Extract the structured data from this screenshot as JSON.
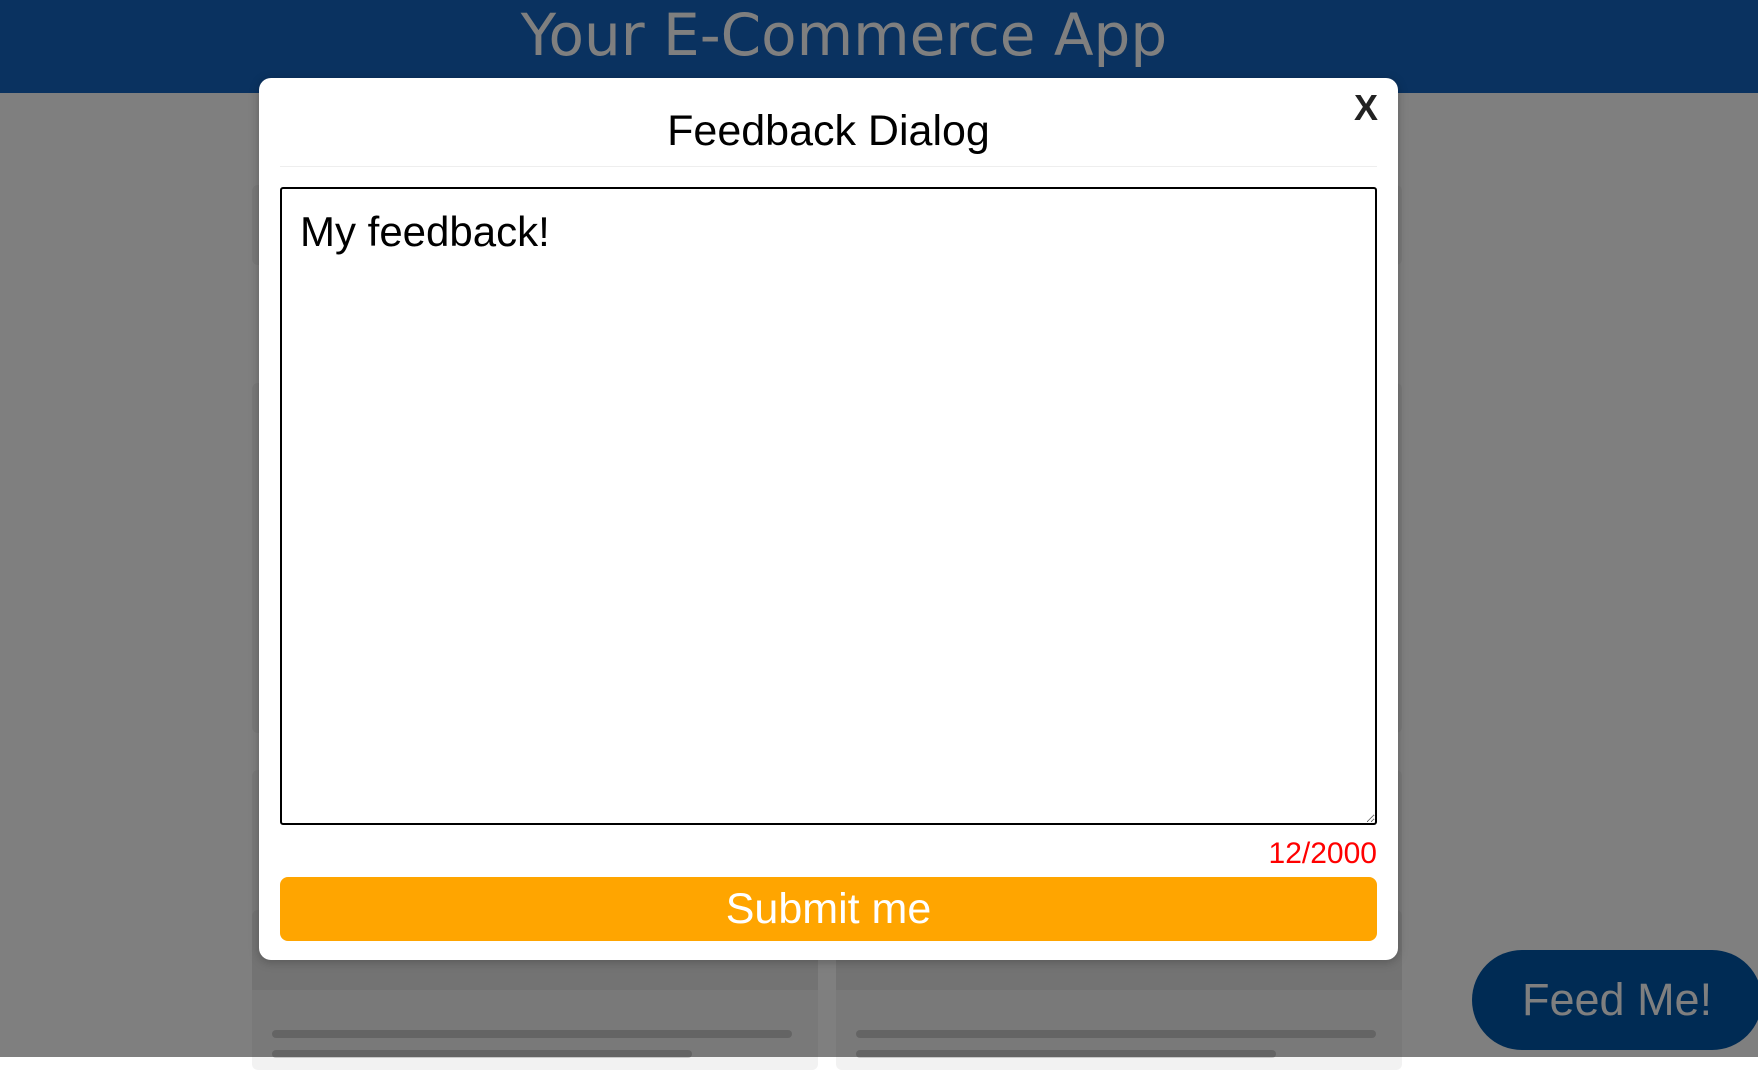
{
  "header": {
    "app_title": "Your E-Commerce App"
  },
  "fab": {
    "label": "Feed Me!"
  },
  "dialog": {
    "title": "Feedback Dialog",
    "close_label": "X",
    "textarea_value": "My feedback!",
    "char_count": "12/2000",
    "submit_label": "Submit me"
  },
  "colors": {
    "header_bg": "#1565c0",
    "submit_bg": "#ffa500",
    "counter_text": "#ff0000",
    "fab_bg": "#0057a8"
  }
}
